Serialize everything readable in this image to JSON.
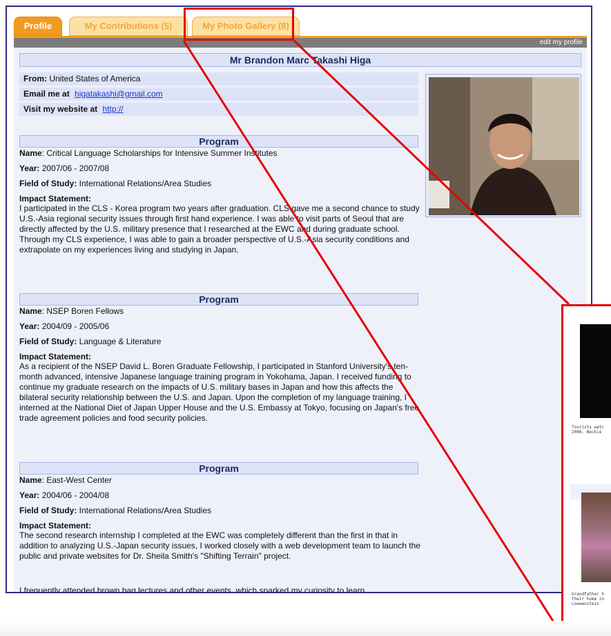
{
  "tabs": [
    {
      "label": "Profile"
    },
    {
      "label": "My Contributions (5)"
    },
    {
      "label": "My Photo Gallery (8)"
    }
  ],
  "toolbar": {
    "edit_link": "edit my profile"
  },
  "profile": {
    "name": "Mr Brandon Marc Takashi Higa",
    "from_label": "From:",
    "from_value": "United States of America",
    "email_label": "Email me at",
    "email_value": "higatakashi@gmail.com",
    "website_label": "Visit my website at",
    "website_value": "http://"
  },
  "programs": [
    {
      "heading": "Program",
      "name_label": "Name",
      "name": "Critical Language Scholarships for Intensive Summer Institutes",
      "year_label": "Year:",
      "year": "2007/06 - 2007/08",
      "field_label": "Field of Study:",
      "field": "International Relations/Area Studies",
      "impact_label": "Impact Statement:",
      "impact": "I participated in the CLS - Korea program two years after graduation.  CLS gave me a second chance to study U.S.-Asia regional security issues through first hand experience.  I was able to visit parts of Seoul that are directly affected by the U.S. military presence that I researched at the EWC and during graduate school.  Through my CLS experience, I was able to gain a broader perspective of U.S.-Asia security conditions and extrapolate on my experiences living and studying in Japan."
    },
    {
      "heading": "Program",
      "name_label": "Name",
      "name": "NSEP Boren Fellows",
      "year_label": "Year:",
      "year": "2004/09 - 2005/06",
      "field_label": "Field of Study:",
      "field": "Language & Literature",
      "impact_label": "Impact Statement:",
      "impact": "As a recipient of the NSEP David L. Boren Graduate Fellowship, I participated in Stanford University's ten-month advanced, intensive Japanese language training program in Yokohama, Japan.  I received funding to continue my graduate research on the impacts of U.S. military bases in Japan and how this affects the bilateral security relationship between the U.S. and Japan.  Upon the completion of my language training, I interned at the National Diet of Japan Upper House and the U.S. Embassy at Tokyo, focusing on Japan's free trade agreement policies and food security policies."
    },
    {
      "heading": "Program",
      "name_label": "Name",
      "name": "East-West Center",
      "year_label": "Year:",
      "year": "2004/06 - 2004/08",
      "field_label": "Field of Study:",
      "field": "International Relations/Area Studies",
      "impact_label": "Impact Statement:",
      "impact": "The second research internship I completed at the EWC was completely different than the first in that in addition to analyzing U.S.-Japan security issues, I worked closely with a web development team to launch the public and private websites for Dr. Sheila Smith's \"Shifting Terrain\" project.",
      "impact_more": "I frequently attended brown bag lectures and other events, which sparked my curiosity to learn"
    }
  ],
  "zoom": {
    "caption1": "Tourists watc\n2008. Beckie",
    "caption2": "Grandfather h\ntheir home in\nLoewenstein"
  },
  "colors": {
    "tab_active": "#f39b1f",
    "tab_inactive": "#fde1a4",
    "frame_border": "#2d2a84",
    "highlight": "#e40000",
    "content_bg": "#eef0fa"
  }
}
